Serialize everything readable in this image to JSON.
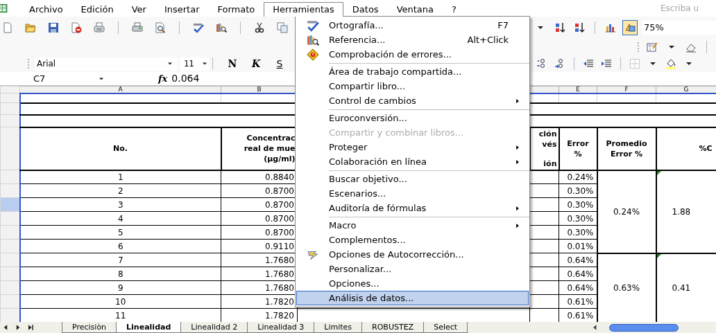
{
  "menu_bar": {
    "items": [
      {
        "label": "Archivo",
        "selected": false
      },
      {
        "label": "Edición",
        "selected": false
      },
      {
        "label": "Ver",
        "selected": false
      },
      {
        "label": "Insertar",
        "selected": false
      },
      {
        "label": "Formato",
        "selected": false
      },
      {
        "label": "Herramientas",
        "selected": true
      },
      {
        "label": "Datos",
        "selected": false
      },
      {
        "label": "Ventana",
        "selected": false
      },
      {
        "label": "?",
        "selected": false
      }
    ]
  },
  "help_box": {
    "placeholder": "Escriba u"
  },
  "zoom_box": {
    "value": "75%"
  },
  "font_box": {
    "value": "Arial"
  },
  "size_box": {
    "value": "11"
  },
  "format_buttons": [
    "N",
    "K",
    "S"
  ],
  "formula_bar": {
    "name_box": "C7",
    "fx": "fx",
    "formula": "0.064"
  },
  "tools_menu": {
    "groups": [
      [
        {
          "label": "Ortografía...",
          "shortcut": "F7",
          "submenu": false,
          "disabled": false,
          "selected": false
        },
        {
          "label": "Referencia...",
          "shortcut": "Alt+Click",
          "submenu": false,
          "disabled": false,
          "selected": false
        },
        {
          "label": "Comprobación de errores...",
          "submenu": false,
          "disabled": false,
          "selected": false
        }
      ],
      [
        {
          "label": "Área de trabajo compartida...",
          "submenu": false,
          "disabled": false,
          "selected": false
        },
        {
          "label": "Compartir libro...",
          "submenu": false,
          "disabled": false,
          "selected": false
        },
        {
          "label": "Control de cambios",
          "submenu": true,
          "disabled": false,
          "selected": false
        }
      ],
      [
        {
          "label": "Euroconversión...",
          "submenu": false,
          "disabled": false,
          "selected": false
        },
        {
          "label": "Compartir y combinar libros...",
          "submenu": false,
          "disabled": true,
          "selected": false
        },
        {
          "label": "Proteger",
          "submenu": true,
          "disabled": false,
          "selected": false
        },
        {
          "label": "Colaboración en línea",
          "submenu": true,
          "disabled": false,
          "selected": false
        }
      ],
      [
        {
          "label": "Buscar objetivo...",
          "submenu": false,
          "disabled": false,
          "selected": false
        },
        {
          "label": "Escenarios...",
          "submenu": false,
          "disabled": false,
          "selected": false
        },
        {
          "label": "Auditoría de fórmulas",
          "submenu": true,
          "disabled": false,
          "selected": false
        }
      ],
      [
        {
          "label": "Macro",
          "submenu": true,
          "disabled": false,
          "selected": false
        },
        {
          "label": "Complementos...",
          "submenu": false,
          "disabled": false,
          "selected": false
        },
        {
          "label": "Opciones de Autocorrección...",
          "submenu": false,
          "disabled": false,
          "selected": false
        },
        {
          "label": "Personalizar...",
          "submenu": false,
          "disabled": false,
          "selected": false
        },
        {
          "label": "Opciones...",
          "submenu": false,
          "disabled": false,
          "selected": false
        },
        {
          "label": "Análisis de datos...",
          "submenu": false,
          "disabled": false,
          "selected": true
        }
      ]
    ]
  },
  "sheet": {
    "column_headers": [
      "A",
      "B",
      "E",
      "F",
      "G"
    ],
    "header": {
      "no": "No.",
      "concentration": [
        "Concentrac",
        "real de mue",
        "(µg/ml)"
      ],
      "column_d": [
        "ción",
        "vés",
        "ión"
      ],
      "error": [
        "Error",
        "%"
      ],
      "avg_error": [
        "Promedio",
        "Error %"
      ],
      "column_g": "%C"
    },
    "groups": [
      {
        "avg_error": "0.24%",
        "column_g": "1.88",
        "rows": [
          {
            "no": "1",
            "concentration": "0.8840",
            "error": "0.24%",
            "selected": false
          },
          {
            "no": "2",
            "concentration": "0.8700",
            "error": "0.30%",
            "selected": false
          },
          {
            "no": "3",
            "concentration": "0.8700",
            "error": "0.30%",
            "selected": true
          },
          {
            "no": "4",
            "concentration": "0.8700",
            "error": "0.30%",
            "selected": false
          },
          {
            "no": "5",
            "concentration": "0.8700",
            "error": "0.30%",
            "selected": false
          },
          {
            "no": "6",
            "concentration": "0.9110",
            "error": "0.01%",
            "selected": false
          }
        ]
      },
      {
        "avg_error": "0.63%",
        "column_g": "0.41",
        "rows": [
          {
            "no": "7",
            "concentration": "1.7680",
            "error": "0.64%",
            "selected": false
          },
          {
            "no": "8",
            "concentration": "1.7680",
            "error": "0.64%",
            "selected": false
          },
          {
            "no": "9",
            "concentration": "1.7680",
            "error": "0.64%",
            "selected": false
          },
          {
            "no": "10",
            "concentration": "1.7820",
            "error": "0.61%",
            "selected": false
          },
          {
            "no": "11",
            "concentration": "1.7820",
            "error": "0.61%",
            "selected": false
          }
        ]
      }
    ]
  },
  "sheet_tabs": [
    {
      "label": "Precisiòn",
      "selected": false
    },
    {
      "label": "Linealidad",
      "selected": true
    },
    {
      "label": "Linealidad 2",
      "selected": false
    },
    {
      "label": "Linealidad 3",
      "selected": false
    },
    {
      "label": "Limites",
      "selected": false
    },
    {
      "label": "ROBUSTEZ",
      "selected": false
    },
    {
      "label": "Select",
      "selected": false
    }
  ]
}
